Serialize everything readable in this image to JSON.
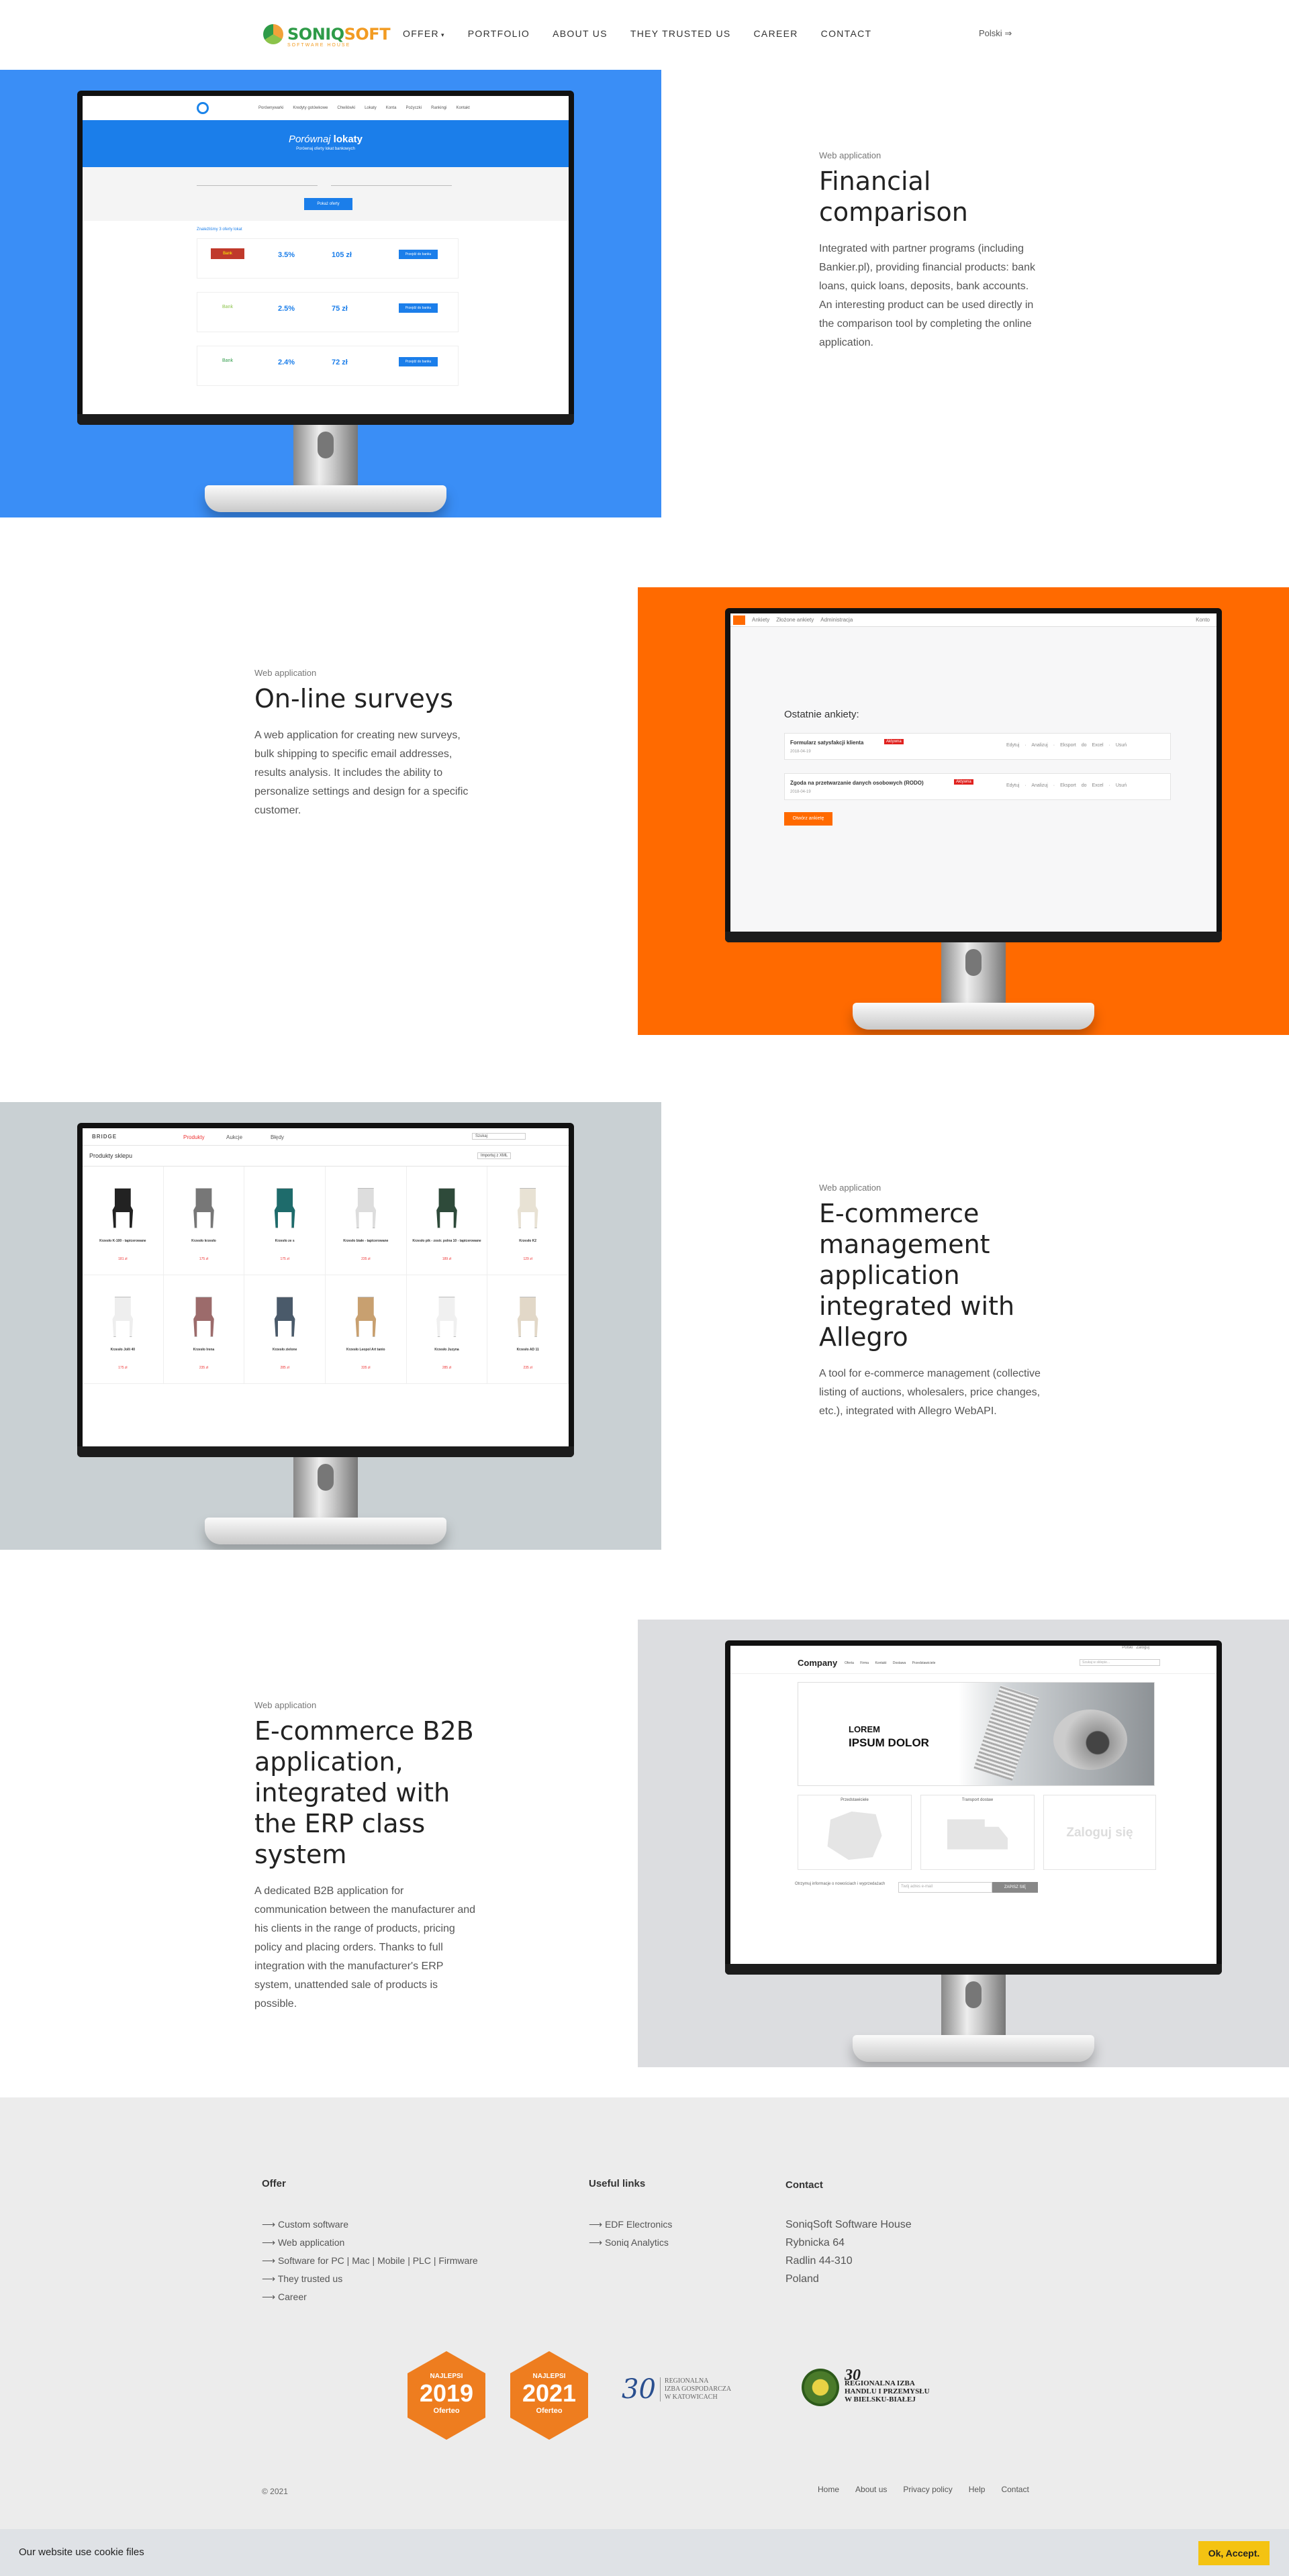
{
  "logo": {
    "part1": "SONIQ",
    "part2": "SOFT",
    "sub": "SOFTWARE HOUSE"
  },
  "nav": [
    {
      "label": "OFFER",
      "has_dropdown": true
    },
    {
      "label": "PORTFOLIO"
    },
    {
      "label": "ABOUT US"
    },
    {
      "label": "THEY TRUSTED US"
    },
    {
      "label": "CAREER"
    },
    {
      "label": "CONTACT"
    }
  ],
  "language": "Polski",
  "colors": {
    "blue": "#3a8ef6",
    "orange": "#ff6a00",
    "grey": "#c9d0d3",
    "light": "#dcdde0",
    "footer": "#ececec",
    "cookie_button": "#f4c312"
  },
  "projects": [
    {
      "category": "Web application",
      "title": "Financial comparison",
      "description": "Integrated with partner programs (including Bankier.pl), providing financial products: bank loans, quick loans, deposits, bank accounts. An interesting product can be used directly in the comparison tool by completing the online application.",
      "screen": {
        "menu": [
          "Porównywarki",
          "Kredyty gotówkowe",
          "Chwilówki",
          "Lokaty",
          "Konta",
          "Pożyczki",
          "Rankingi",
          "Kontakt"
        ],
        "hero_title_a": "Porównaj",
        "hero_title_b": "lokaty",
        "hero_sub": "Porównaj oferty lokat bankowych",
        "button": "Pokaż oferty",
        "results": "Znaleźliśmy 3 oferty lokat",
        "offers": [
          {
            "logo": "Bank",
            "rate": "3.5%",
            "profit": "105 zł",
            "cta": "Przejdź do banku"
          },
          {
            "logo": "Bank",
            "rate": "2.5%",
            "profit": "75 zł",
            "cta": "Przejdź do banku"
          },
          {
            "logo": "Bank",
            "rate": "2.4%",
            "profit": "72 zł",
            "cta": "Przejdź do banku"
          }
        ]
      }
    },
    {
      "category": "Web application",
      "title": "On-line surveys",
      "description": "A web application for creating new surveys, bulk shipping to specific email addresses, results analysis. It includes the ability to personalize settings and design for a specific customer.",
      "screen": {
        "tabs": [
          "Ankiety",
          "Złożone ankiety",
          "Administracja"
        ],
        "user": "Konto",
        "heading": "Ostatnie ankiety:",
        "surveys": [
          {
            "name": "Formularz satysfakcji klienta",
            "tag": "Aktywna",
            "date": "2018-04-19"
          },
          {
            "name": "Zgoda na przetwarzanie danych osobowych (RODO)",
            "tag": "Aktywna",
            "date": "2018-04-19"
          }
        ],
        "actions": [
          "Edytuj",
          "Analizuj",
          "Eksport do Excel",
          "Usuń"
        ],
        "button": "Otwórz ankietę"
      }
    },
    {
      "category": "Web application",
      "title": "E-commerce management application integrated with Allegro",
      "description": "A tool for e-commerce management (collective listing of auctions, wholesalers, price changes, etc.), integrated with Allegro WebAPI.",
      "screen": {
        "brand": "BRIDGE",
        "tabs": [
          "Produkty",
          "Aukcje",
          "Błędy"
        ],
        "search": "Szukaj",
        "section": "Produkty sklepu",
        "export": "Importuj z XML",
        "products": [
          {
            "name": "Krzesło K-100 - tapicerowane",
            "price": "181 zł"
          },
          {
            "name": "Krzesło krzesło",
            "price": "175 zł"
          },
          {
            "name": "Krzesło ze s",
            "price": "175 zł"
          },
          {
            "name": "Krzesło białe - tapicerowane",
            "price": "235 zł"
          },
          {
            "name": "Krzesło pik - zostr. polna 10 - tapicerowane",
            "price": "189 zł"
          },
          {
            "name": "Krzesło K2",
            "price": "129 zł"
          },
          {
            "name": "Krzesło Jolli 40",
            "price": "175 zł"
          },
          {
            "name": "Krzesło Irena",
            "price": "235 zł"
          },
          {
            "name": "Krzesło zielone",
            "price": "285 zł"
          },
          {
            "name": "Krzesło Leopol Art tanio",
            "price": "335 zł"
          },
          {
            "name": "Krzesło Juzyna",
            "price": "285 zł"
          },
          {
            "name": "Krzesło AD 11",
            "price": "235 zł"
          }
        ]
      }
    },
    {
      "category": "Web application",
      "title": "E-commerce B2B application, integrated with the ERP class system",
      "description": "A dedicated B2B application for communication between the manufacturer and his clients in the range of products, pricing policy and placing orders. Thanks to full integration with the manufacturer's ERP system, unattended sale of products is possible.",
      "screen": {
        "lang": "Polski",
        "login": "Zaloguj",
        "brand": "Company",
        "menu": [
          "Oferta",
          "Firma",
          "Kontakt",
          "Dostawa",
          "Przedstawiciele"
        ],
        "search": "Szukaj w sklepie...",
        "banner_a": "LOREM",
        "banner_b": "IPSUM DOLOR",
        "boxes": [
          "Przedstawiciele",
          "Transport dostaw",
          "Zaloguj się"
        ],
        "newsletter_label": "Otrzymuj informacje o nowościach i wyprzedażach",
        "newsletter_placeholder": "Twój adres e-mail",
        "newsletter_button": "ZAPISZ SIĘ"
      }
    }
  ],
  "footer": {
    "offer_title": "Offer",
    "offer_links": [
      "Custom software",
      "Web application",
      "Software for PC | Mac | Mobile | PLC | Firmware",
      "They trusted us",
      "Career"
    ],
    "useful_title": "Useful links",
    "useful_links": [
      "EDF Electronics",
      "Soniq Analytics"
    ],
    "contact_title": "Contact",
    "contact_lines": [
      "SoniqSoft Software House",
      "Rybnicka 64",
      "Radlin 44-310",
      "Poland"
    ],
    "badges": [
      {
        "small": "NAJLEPSI",
        "year": "2019",
        "sub": "Oferteo"
      },
      {
        "small": "NAJLEPSI",
        "year": "2021",
        "sub": "Oferteo"
      }
    ],
    "chambers": [
      {
        "mark": "30",
        "text": [
          "REGIONALNA",
          "IZBA GOSPODARCZA",
          "W KATOWICACH"
        ]
      },
      {
        "mark": "30",
        "text": [
          "REGIONALNA IZBA",
          "HANDLU I PRZEMYSŁU",
          "W BIELSKU-BIAŁEJ"
        ]
      }
    ],
    "copyright": "© 2021",
    "bottom_links": [
      "Home",
      "About us",
      "Privacy policy",
      "Help",
      "Contact"
    ]
  },
  "cookie": {
    "text": "Our website use cookie files",
    "button": "Ok, Accept."
  }
}
